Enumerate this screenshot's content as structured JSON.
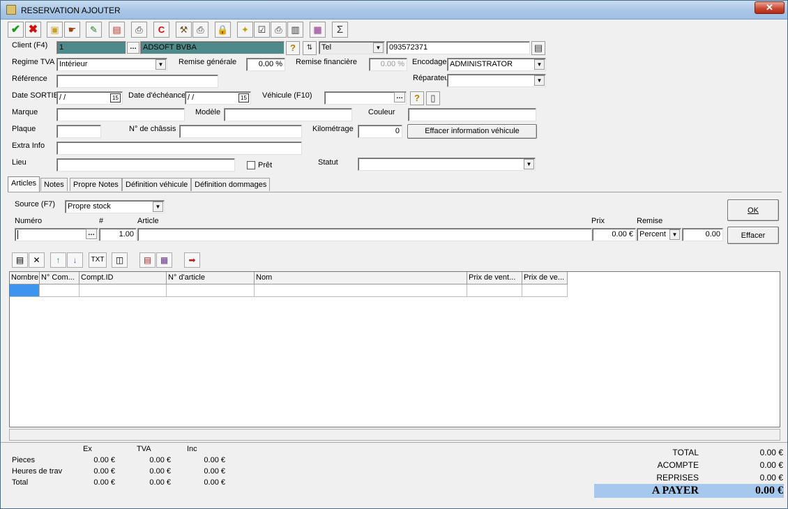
{
  "window": {
    "title": "RESERVATION AJOUTER",
    "close_label": "✕"
  },
  "toolbar": {
    "icons": [
      "check-icon",
      "cross-icon",
      "tool-a-icon",
      "tool-b-icon",
      "tool-c-icon",
      "tool-d-icon",
      "printer-icon",
      "red-circle-icon",
      "tool-e-icon",
      "printer2-icon",
      "lock-icon",
      "tool-f-icon",
      "checkbox-icon",
      "printer3-icon",
      "printer4-icon",
      "tool-g-icon",
      "sigma-icon"
    ]
  },
  "header": {
    "client_label": "Client (F4)",
    "client_id": "1",
    "client_name": "ADSOFT BVBA",
    "phone_type": "Tel",
    "phone_number": "093572371",
    "regime_label": "Regime TVA",
    "regime_value": "Intérieur",
    "remise_generale_label": "Remise générale",
    "remise_generale_value": "0.00 %",
    "remise_financiere_label": "Remise financière",
    "remise_financiere_value": "0.00 %",
    "encodage_label": "Encodage",
    "encodage_value": "ADMINISTRATOR",
    "reference_label": "Référence",
    "reparateur_label": "Réparateu",
    "date_sortie_label": "Date SORTIE",
    "date_sortie_value": " / /",
    "date_echeance_label": "Date d'échéance",
    "date_echeance_value": " / /",
    "vehicule_label": "Véhicule (F10)",
    "marque_label": "Marque",
    "modele_label": "Modèle",
    "couleur_label": "Couleur",
    "plaque_label": "Plaque",
    "chassis_label": "N° de châssis",
    "kilometrage_label": "Kilométrage",
    "kilometrage_value": "0",
    "effacer_vehicule_label": "Effacer information véhicule",
    "extra_info_label": "Extra Info",
    "lieu_label": "Lieu",
    "pret_label": "Prêt",
    "statut_label": "Statut"
  },
  "tabs": [
    "Articles",
    "Notes",
    "Propre Notes",
    "Définition véhicule",
    "Définition dommages"
  ],
  "articles": {
    "source_label": "Source (F7)",
    "source_value": "Propre stock",
    "numero_label": "Numéro",
    "qty_label": "#",
    "qty_value": "1.00",
    "article_label": "Article",
    "prix_label": "Prix",
    "prix_value": "0.00 €",
    "remise_label": "Remise",
    "remise_type": "Percent",
    "remise_value": "0.00",
    "ok_label": "OK",
    "effacer_label": "Effacer"
  },
  "grid_toolbar": {
    "txt_label": "TXT"
  },
  "grid": {
    "columns": [
      "Nombre",
      "N° Com...",
      "Compt.ID",
      "N° d'article",
      "Nom",
      "Prix de vent...",
      "Prix de ve..."
    ]
  },
  "summary": {
    "headers": [
      "Ex",
      "TVA",
      "Inc"
    ],
    "rows": [
      {
        "label": "Pieces",
        "ex": "0.00 €",
        "tva": "0.00 €",
        "inc": "0.00 €"
      },
      {
        "label": "Heures de trav",
        "ex": "0.00 €",
        "tva": "0.00 €",
        "inc": "0.00 €"
      },
      {
        "label": "Total",
        "ex": "0.00 €",
        "tva": "0.00 €",
        "inc": "0.00 €"
      }
    ]
  },
  "totals": {
    "total_label": "TOTAL",
    "total_value": "0.00 €",
    "acompte_label": "ACOMPTE",
    "acompte_value": "0.00 €",
    "reprises_label": "REPRISES",
    "reprises_value": "0.00 €",
    "apayer_label": "A PAYER",
    "apayer_value": "0.00 €"
  }
}
